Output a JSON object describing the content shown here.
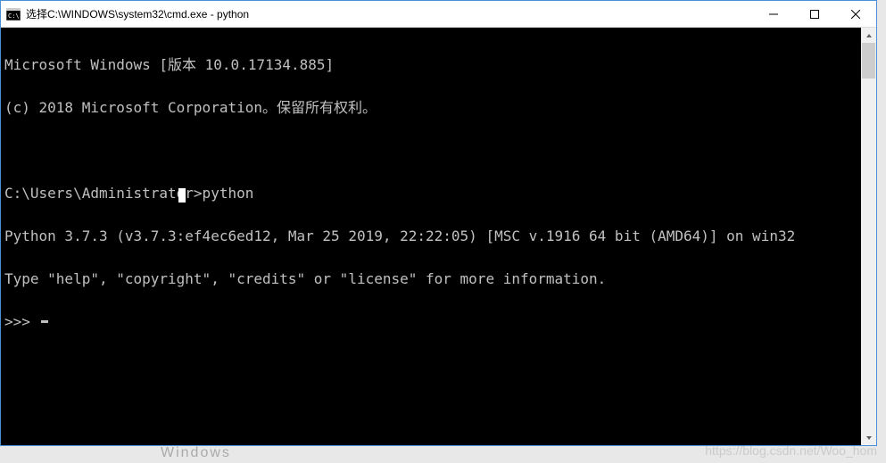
{
  "titlebar": {
    "title": "选择C:\\WINDOWS\\system32\\cmd.exe - python"
  },
  "terminal": {
    "lines": [
      "Microsoft Windows [版本 10.0.17134.885]",
      "(c) 2018 Microsoft Corporation。保留所有权利。",
      "",
      "C:\\Users\\Administrator>python",
      "Python 3.7.3 (v3.7.3:ef4ec6ed12, Mar 25 2019, 22:22:05) [MSC v.1916 64 bit (AMD64)] on win32",
      "Type \"help\", \"copyright\", \"credits\" or \"license\" for more information."
    ],
    "prompt": ">>> "
  },
  "watermark": "https://blog.csdn.net/Woo_hom",
  "background_hint": "Windows"
}
